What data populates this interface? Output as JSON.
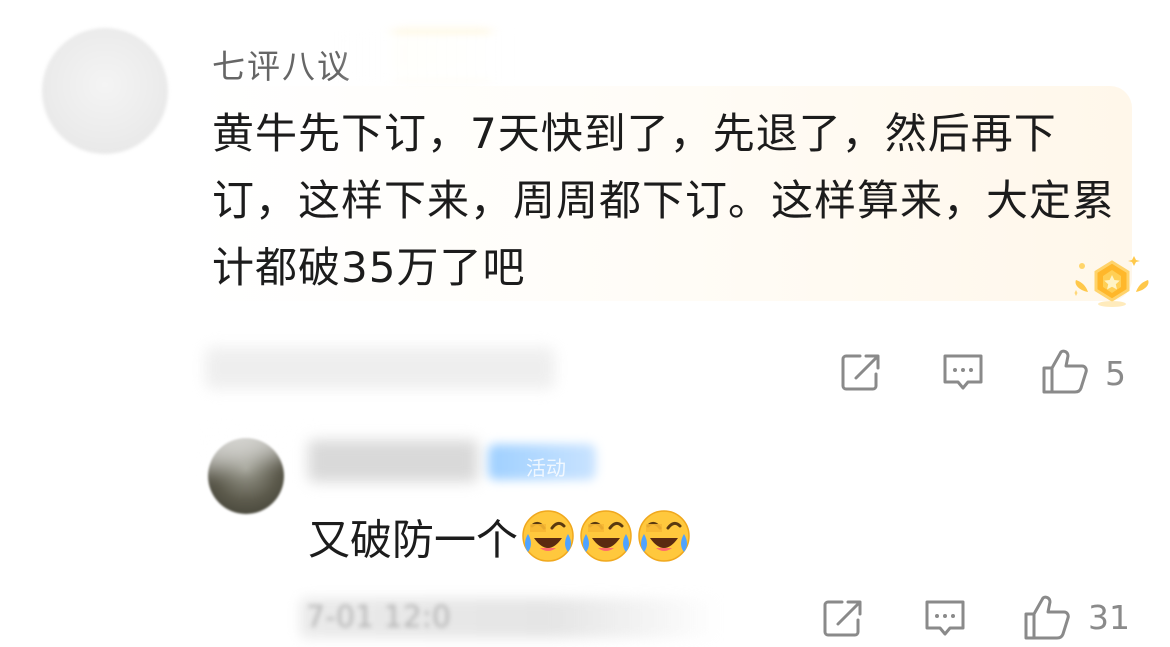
{
  "comment": {
    "username": "七评八议",
    "text": "黄牛先下订，7天快到了，先退了，然后再下订，这样下来，周周都下订。这样算来，大定累计都破35万了吧",
    "like_count": "5",
    "share_icon": "share-icon",
    "reply_icon": "reply-icon",
    "like_icon": "thumbs-up-icon",
    "medal_icon": "gold-medal-icon"
  },
  "reply": {
    "badge_text": "活动",
    "text": "又破防一个",
    "emoji_icon": "laughing-crying-emoji-icon",
    "emoji_count": 3,
    "meta_partial": "7-01 12:0",
    "like_count": "31"
  },
  "colors": {
    "icon_gray": "#8a8a8a",
    "text_dark": "#1c1c1c",
    "username_gray": "#666666",
    "bubble_tint": "#fff7ea",
    "emoji_yellow": "#ffc83d",
    "emoji_tear_blue": "#4fa3ff"
  }
}
